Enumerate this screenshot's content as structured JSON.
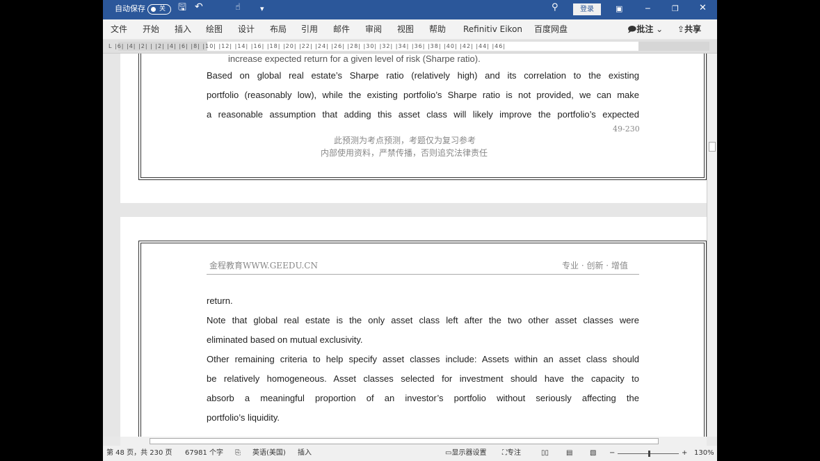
{
  "titlebar": {
    "autosave": "自动保存",
    "autosave_state": "关",
    "login": "登录"
  },
  "ribbon": {
    "tabs": [
      "文件",
      "开始",
      "插入",
      "绘图",
      "设计",
      "布局",
      "引用",
      "邮件",
      "审阅",
      "视图",
      "帮助",
      "Refinitiv Eikon",
      "百度网盘"
    ],
    "comments": "批注",
    "share": "共享"
  },
  "ruler": {
    "ticks": "L  |6|  |4|  |2|  |  |2|  |4|  |6|  |8|  |10|  |12|  |14|  |16|  |18|  |20|  |22|  |24|  |26|  |28|  |30|  |32|  |34|  |36|  |38|  |40|  |42|  |44|  |46|"
  },
  "page1": {
    "lines": [
      "increase expected return for a given level of risk (Sharpe ratio).",
      "Based on global real estate’s Sharpe ratio (relatively high) and its correlation to the existing",
      "portfolio (reasonably low), while the existing portfolio’s Sharpe ratio is not provided, we can make",
      "a reasonable assumption that adding this asset class will likely improve the portfolio’s expected"
    ],
    "page_num": "49-230",
    "footer1": "此预测为考点预测，考题仅为复习参考",
    "footer2": "内部使用资料，严禁传播，否则追究法律责任"
  },
  "page2": {
    "header_left": "金程教育WWW.GEEDU.CN",
    "header_right": "专业 · 创新 · 增值",
    "lines": [
      "return.",
      "Note that global real estate is the only asset class left after the two other asset classes were",
      "eliminated based on mutual exclusivity.",
      "Other remaining criteria to help specify asset classes include: Assets within an asset class should",
      "be relatively homogeneous. Asset classes selected for investment should have the capacity to",
      "absorb a meaningful proportion of an investor’s portfolio without seriously affecting the",
      "portfolio’s liquidity."
    ]
  },
  "status": {
    "page": "第 48 页，共 230 页",
    "words": "67981 个字",
    "lang": "英语(美国)",
    "mode": "插入",
    "display": "显示器设置",
    "focus": "专注",
    "zoom": "130%",
    "zoom_level": 130
  }
}
